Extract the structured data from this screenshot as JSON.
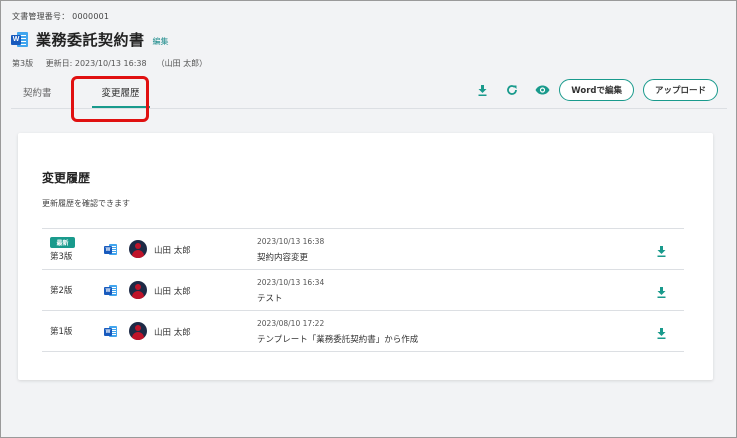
{
  "header": {
    "doc_number_label": "文書管理番号：",
    "doc_number": "0000001",
    "title": "業務委託契約書",
    "edit_label": "編集",
    "version": "第3版",
    "updated": "更新日: 2023/10/13 16:38",
    "updated_by": "（山田 太郎）"
  },
  "tabs": [
    {
      "label": "契約書"
    },
    {
      "label": "変更履歴"
    }
  ],
  "toolbar": {
    "word_edit_label": "Wordで編集",
    "upload_label": "アップロード",
    "icons": [
      "download-icon",
      "refresh-icon",
      "eye-icon"
    ]
  },
  "history": {
    "title": "変更履歴",
    "subtitle": "更新履歴を確認できます",
    "rows": [
      {
        "badge": "最新",
        "version": "第3版",
        "user": "山田 太郎",
        "date": "2023/10/13 16:38",
        "comment": "契約内容変更"
      },
      {
        "badge": "",
        "version": "第2版",
        "user": "山田 太郎",
        "date": "2023/10/13 16:34",
        "comment": "テスト"
      },
      {
        "badge": "",
        "version": "第1版",
        "user": "山田 太郎",
        "date": "2023/08/10 17:22",
        "comment": "テンプレート「業務委託契約書」から作成"
      }
    ]
  },
  "colors": {
    "accent": "#199a8c",
    "highlight": "#e01010",
    "word_blue": "#185abd",
    "avatar_bg": "#1e2a46"
  }
}
